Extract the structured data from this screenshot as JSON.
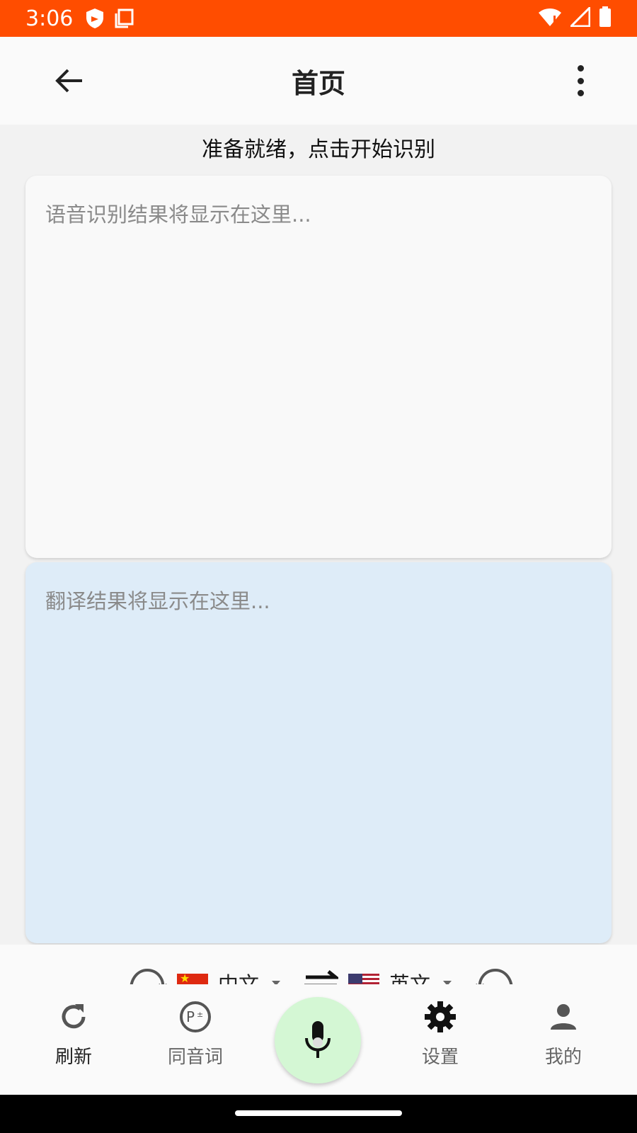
{
  "status_bar": {
    "time": "3:06"
  },
  "app_bar": {
    "title": "首页"
  },
  "status_message": "准备就绪，点击开始识别",
  "source_card": {
    "placeholder": "语音识别结果将显示在这里..."
  },
  "target_card": {
    "placeholder": "翻译结果将显示在这里..."
  },
  "language_bar": {
    "source_language": "中文",
    "target_language": "英文"
  },
  "bottom_nav": {
    "items": [
      {
        "label": "刷新",
        "icon": "refresh-icon"
      },
      {
        "label": "同音词",
        "icon": "homophone-icon"
      },
      {
        "label": "设置",
        "icon": "gear-icon"
      },
      {
        "label": "我的",
        "icon": "person-icon"
      }
    ],
    "mic_icon": "mic-icon"
  },
  "colors": {
    "status_bar": "#ff4d00",
    "target_card": "#deecf8",
    "mic_button": "#d4f7d4"
  }
}
